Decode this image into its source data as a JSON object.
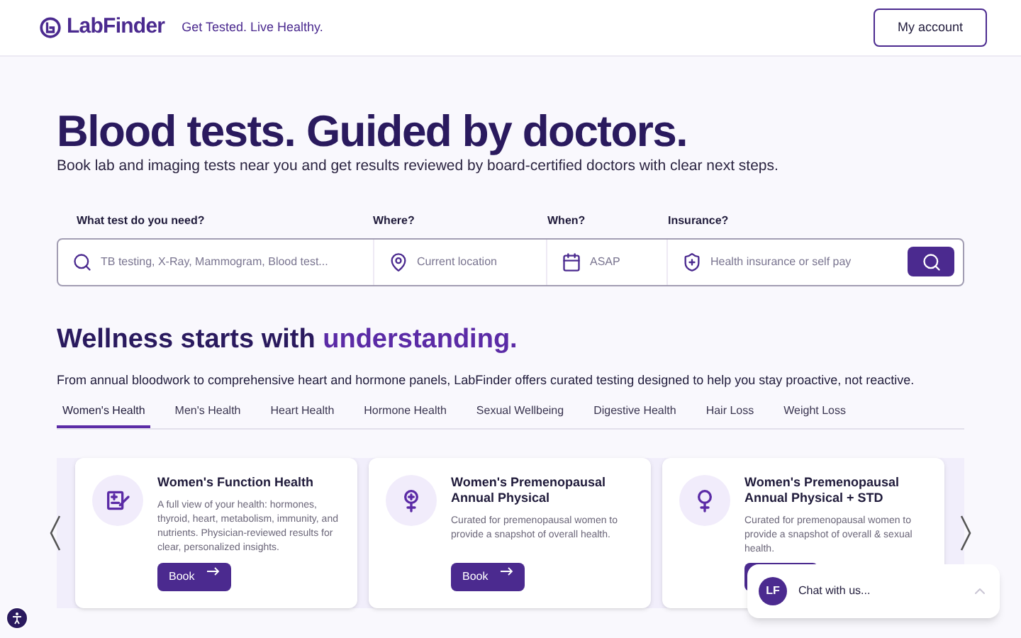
{
  "header": {
    "logo": "LabFinder",
    "tagline": "Get Tested. Live Healthy.",
    "account_button": "My account"
  },
  "hero": {
    "title": "Blood tests. Guided by doctors.",
    "subtitle": "Book lab and imaging tests near you and get results reviewed by board-certified doctors with clear next steps."
  },
  "search": {
    "fields": [
      {
        "kind": "test",
        "label": "What test do you need?",
        "placeholder": "TB testing, X-Ray, Mammogram, Blood test..."
      },
      {
        "kind": "location",
        "label": "Where?",
        "placeholder": "Current location"
      },
      {
        "kind": "date",
        "label": "When?",
        "placeholder": "ASAP"
      },
      {
        "kind": "insurance",
        "label": "Insurance?",
        "placeholder": "Health insurance or self pay"
      }
    ]
  },
  "wellness": {
    "heading": "Wellness starts with",
    "heading_accent": "understanding.",
    "intro": "From annual bloodwork to comprehensive heart and hormone panels, LabFinder offers curated testing designed to help you stay proactive, not reactive.",
    "tabs": [
      {
        "label": "Women's Health",
        "selected": true
      },
      {
        "label": "Men's Health",
        "selected": false
      },
      {
        "label": "Heart Health",
        "selected": false
      },
      {
        "label": "Hormone Health",
        "selected": false
      },
      {
        "label": "Sexual Wellbeing",
        "selected": false
      },
      {
        "label": "Digestive Health",
        "selected": false
      },
      {
        "label": "Hair Loss",
        "selected": false
      },
      {
        "label": "Weight Loss",
        "selected": false
      }
    ],
    "cards": [
      {
        "kind": "clipboard",
        "title": "Women's Function Health",
        "description": "A full view of your health: hormones, thyroid, heart, metabolism, immunity, and nutrients. Physician-reviewed results for clear, personalized insights.",
        "button": "Book"
      },
      {
        "kind": "female-plus",
        "title": "Women's Premenopausal Annual Physical",
        "description": "Curated for premenopausal women to provide a snapshot of overall health.",
        "button": "Book"
      },
      {
        "kind": "female",
        "title": "Women's Premenopausal Annual Physical + STD",
        "description": "Curated for premenopausal women to provide a snapshot of overall & sexual health."
      }
    ]
  },
  "chat": {
    "avatar": "LF",
    "prompt": "Chat with us..."
  }
}
